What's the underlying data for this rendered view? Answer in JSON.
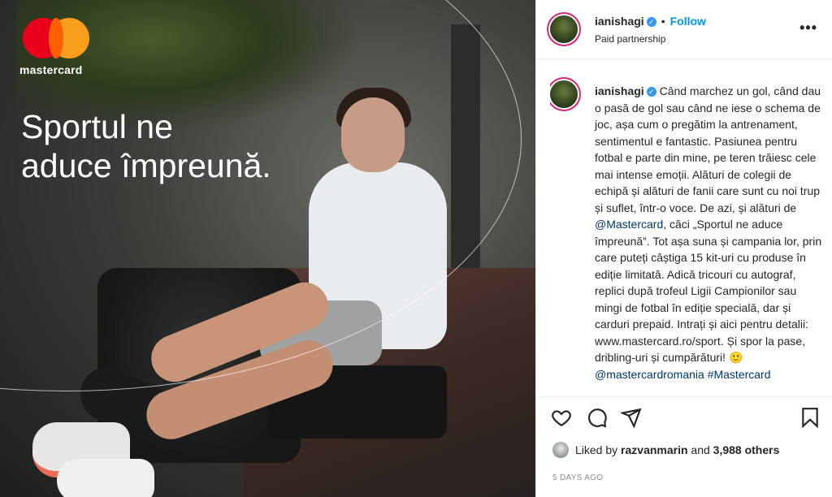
{
  "media": {
    "brand_name": "mastercard",
    "tagline_line1": "Sportul ne",
    "tagline_line2": "aduce împreună."
  },
  "header": {
    "username": "ianishagi",
    "follow_label": "Follow",
    "subtitle": "Paid partnership",
    "more_icon": "•••"
  },
  "caption": {
    "username": "ianishagi",
    "text": "Când marchez un gol, când dau o pasă de gol sau când ne iese o schema de joc, așa cum o pregătim la antrenament, sentimentul e fantastic. Pasiunea pentru fotbal e parte din mine, pe teren trăiesc cele mai intense emoții. Alături de colegii de echipă și alături de fanii care sunt cu noi trup și suflet, într-o voce. De azi, și alături de ",
    "mention1": "@Mastercard",
    "text2": ", căci „Sportul ne aduce împreună”. Tot așa suna și campania lor, prin care puteți câștiga 15 kit-uri cu produse în ediție limitată. Adică tricouri cu autograf, replici după trofeul Ligii Campionilor sau mingi de fotbal în ediție specială, dar și carduri prepaid. Intrați și aici pentru detalii: www.mastercard.ro/sport. Și spor la pase, dribling-uri și cumpărături! 🙂 ",
    "mention2": "@mastercardromania",
    "hashtag": " #Mastercard"
  },
  "actions": {
    "icons": [
      "heart-icon",
      "comment-icon",
      "share-icon",
      "bookmark-icon"
    ]
  },
  "likes": {
    "prefix": "Liked by",
    "user": "razvanmarin",
    "and": "and",
    "count": "3,988 others"
  },
  "timestamp": "5 DAYS AGO",
  "colors": {
    "accent_blue": "#0095f6",
    "mention_color": "#00376b",
    "mc_red": "#eb001b",
    "mc_yellow": "#f79e1b"
  }
}
